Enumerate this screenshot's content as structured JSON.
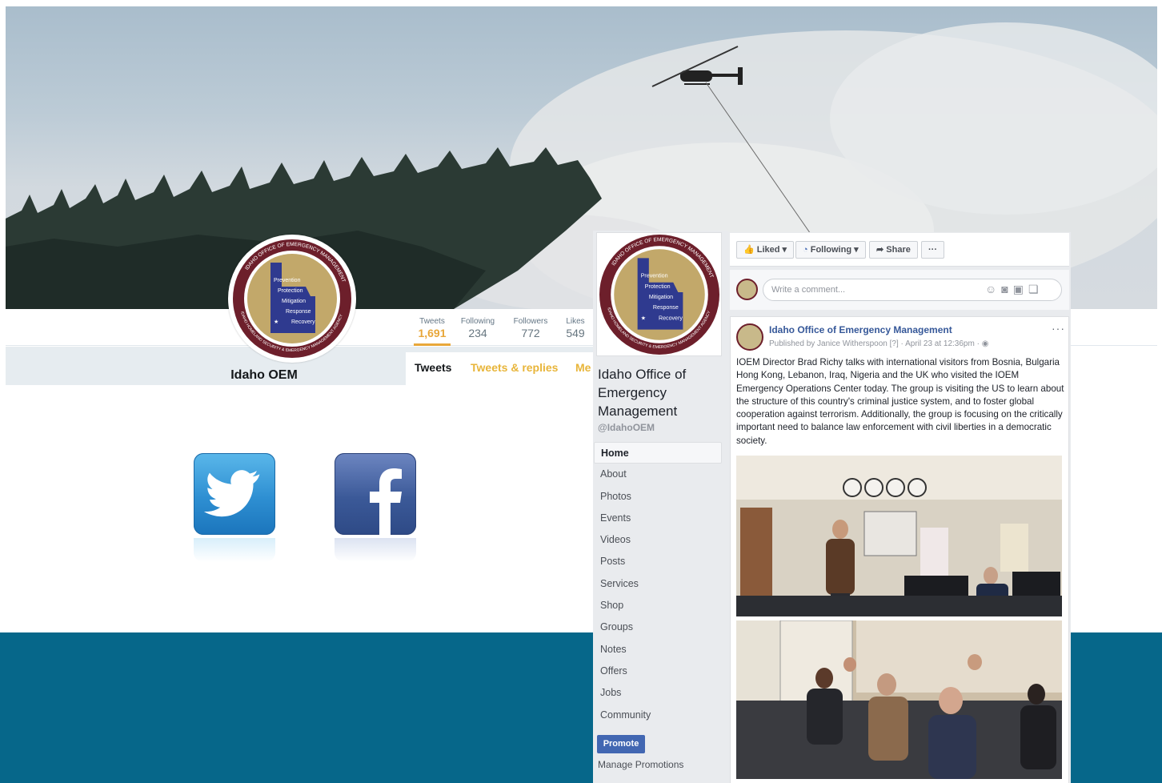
{
  "twitter": {
    "name": "Idaho OEM",
    "stats": [
      {
        "label": "Tweets",
        "value": "1,691"
      },
      {
        "label": "Following",
        "value": "234"
      },
      {
        "label": "Followers",
        "value": "772"
      },
      {
        "label": "Likes",
        "value": "549"
      }
    ],
    "tabs": [
      "Tweets",
      "Tweets & replies",
      "Me"
    ]
  },
  "seal": {
    "ring_text": "IDAHO OFFICE OF EMERGENCY MANAGEMENT",
    "ring_text_lower": "IDAHO HOMELAND SECURITY & EMERGENCY MANAGEMENT AGENCY",
    "lines": [
      "Prevention",
      "Protection",
      "Mitigation",
      "Response",
      "Recovery"
    ]
  },
  "facebook": {
    "page_name": "Idaho Office of Emergency Management",
    "handle": "@IdahoOEM",
    "nav": [
      "Home",
      "About",
      "Photos",
      "Events",
      "Videos",
      "Posts",
      "Services",
      "Shop",
      "Groups",
      "Notes",
      "Offers",
      "Jobs",
      "Community"
    ],
    "promote": "Promote",
    "manage_promotions": "Manage Promotions",
    "actions": {
      "liked": "Liked ▾",
      "following": "Following ▾",
      "share": "Share",
      "more": "···"
    },
    "comment_placeholder": "Write a comment...",
    "post": {
      "author": "Idaho Office of Emergency Management",
      "meta": "Published by Janice Witherspoon [?] · April 23 at 12:36pm · ◉",
      "more": "···",
      "text": "IOEM Director Brad Richy talks with international visitors from Bosnia, Bulgaria Hong Kong, Lebanon, Iraq, Nigeria and the UK who visited the IOEM Emergency Operations Center today. The group is visiting the US to learn about the structure of this country's criminal justice system, and to foster global cooperation against terrorism. Additionally, the group is focusing on the critically important need to balance law enforcement with civil liberties in a democratic society."
    }
  },
  "colors": {
    "twitter_accent": "#e8a73a",
    "facebook_blue": "#4267b2",
    "bottom_band": "#06678a",
    "seal_maroon": "#6d1f2b",
    "seal_gold": "#c2a86a"
  }
}
